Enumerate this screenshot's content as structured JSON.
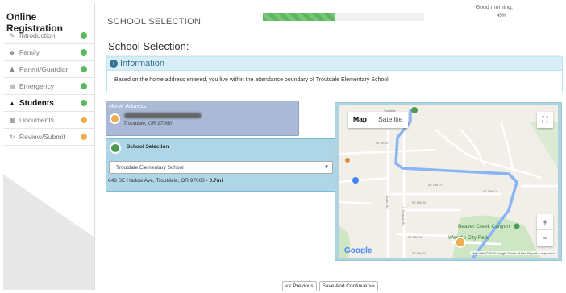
{
  "sidebar": {
    "title": "Online Registration",
    "items": [
      {
        "label": "Introduction",
        "icon": "pencil-icon",
        "status": "complete",
        "active": false
      },
      {
        "label": "Family",
        "icon": "family-icon",
        "status": "complete",
        "active": false
      },
      {
        "label": "Parent/Guardian",
        "icon": "user-icon",
        "status": "complete",
        "active": false
      },
      {
        "label": "Emergency",
        "icon": "card-icon",
        "status": "complete",
        "active": false
      },
      {
        "label": "Students",
        "icon": "graduation-cap-icon",
        "status": "complete",
        "active": true
      },
      {
        "label": "Documents",
        "icon": "document-icon",
        "status": "pending",
        "active": false
      },
      {
        "label": "Review/Submit",
        "icon": "refresh-icon",
        "status": "pending",
        "active": false
      }
    ]
  },
  "header": {
    "greeting": "Good morning,",
    "progress_label": "45%",
    "progress_value": 45,
    "page_title": "SCHOOL SELECTION"
  },
  "main": {
    "section_title": "School Selection:",
    "info": {
      "title": "Information",
      "icon": "info-circle-icon",
      "text": "Based on the home address entered, you live within the attendance boundary of Troutdale Elementary School"
    },
    "home": {
      "label": "Home Address:",
      "city": "Troutdale, OR 97060"
    },
    "school": {
      "label": "School Selection",
      "selected": "Troutdale Elementary School",
      "address": "648 SE Harlow Ave, Troutdale, OR 97060 - ",
      "distance": "0.7mi"
    }
  },
  "map": {
    "btn_map": "Map",
    "btn_satellite": "Satellite",
    "zoom_in": "+",
    "zoom_out": "−",
    "google": "Google",
    "footer": "Map data ©2019 Google   Terms of Use   Report a map error",
    "school_label": "Troutdale",
    "park_label": "Beaver Creek Canyon",
    "park2_label": "Weedin City Park",
    "roads": [
      "SE 11th Ct",
      "SE 12th St",
      "SE 13th St",
      "SE 14th St",
      "SE 4th St",
      "SE 11th Ct",
      "Buxton Rd",
      "S Troutdale Rd"
    ]
  },
  "pager": {
    "previous": "<< Previous",
    "next": "Save And Continue >>"
  },
  "colors": {
    "accent_green": "#5cb85c",
    "warn_orange": "#f0ad4e",
    "info_blue": "#31708f",
    "route_blue": "#8ab4f8"
  }
}
